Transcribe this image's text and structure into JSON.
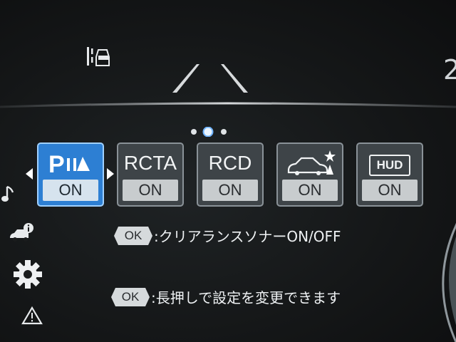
{
  "header": {
    "top_right_digit": "2"
  },
  "pager": {
    "pages": 3,
    "active_index": 1
  },
  "tiles": [
    {
      "id": "parking-sensor",
      "label": "",
      "status": "ON",
      "selected": true,
      "icon": "parking-sensor-icon"
    },
    {
      "id": "rcta",
      "label": "RCTA",
      "status": "ON",
      "selected": false
    },
    {
      "id": "rcd",
      "label": "RCD",
      "status": "ON",
      "selected": false
    },
    {
      "id": "pre-collision",
      "label": "",
      "status": "ON",
      "selected": false,
      "icon": "car-collision-icon"
    },
    {
      "id": "hud",
      "label": "",
      "status": "ON",
      "selected": false,
      "icon": "hud-icon",
      "icon_text": "HUD"
    }
  ],
  "info": {
    "ok_label": "OK",
    "line1": ":クリアランスソナーON/OFF",
    "line2": ":長押しで設定を変更できます"
  },
  "sidebar": {
    "icons": [
      "music-note-icon",
      "vehicle-info-icon",
      "settings-gear-icon",
      "warning-triangle-icon"
    ]
  },
  "colors": {
    "selected_tile": "#2d7fd3",
    "tile": "#3e4448",
    "status_bg": "#c8ccce"
  }
}
